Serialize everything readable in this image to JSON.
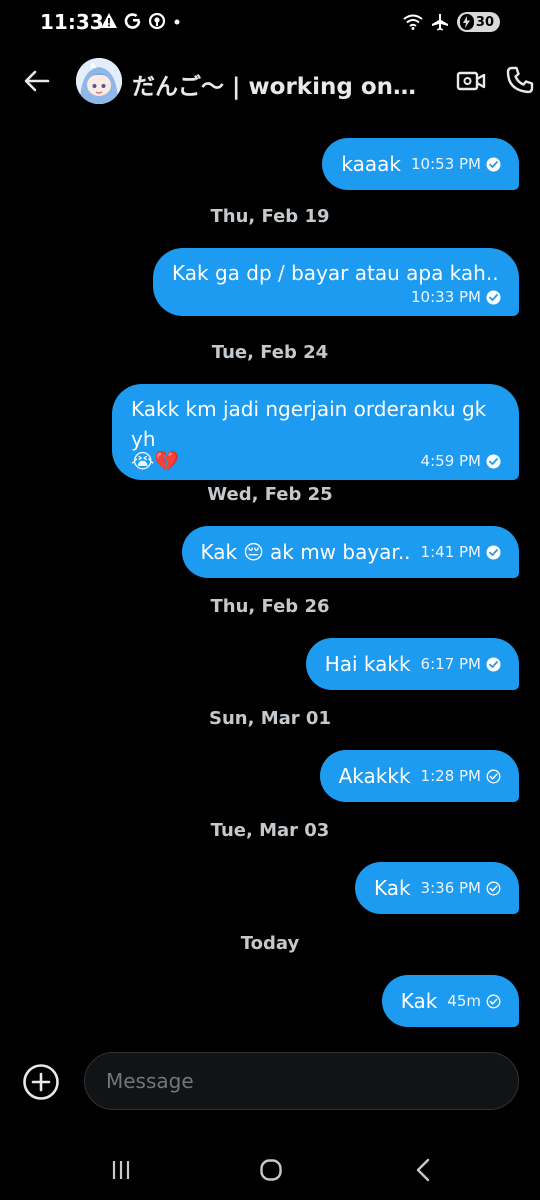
{
  "status_bar": {
    "time": "11:33",
    "battery": "30",
    "left_icons": [
      "warning-icon",
      "google-icon",
      "location-icon",
      "dot-icon"
    ],
    "right_icons": [
      "wifi-icon",
      "airplane-icon",
      "battery-icon"
    ]
  },
  "header": {
    "title": "だんご〜 | working on c...",
    "icons": [
      "back-arrow-icon",
      "avatar",
      "video-call-icon",
      "phone-icon"
    ]
  },
  "messages": [
    {
      "type": "bubble",
      "text": "kaaak",
      "time": "10:53 PM",
      "status": "read"
    },
    {
      "type": "date",
      "text": "Thu, Feb 19"
    },
    {
      "type": "bubble",
      "text": "Kak ga dp / bayar atau apa kah..",
      "time": "10:33 PM",
      "status": "read"
    },
    {
      "type": "date",
      "text": "Tue, Feb 24"
    },
    {
      "type": "bubble",
      "text": "Kakk km jadi ngerjain orderanku gk yh",
      "emoji": "😭💔",
      "time": "4:59 PM",
      "status": "read"
    },
    {
      "type": "date",
      "text": "Wed, Feb 25"
    },
    {
      "type": "bubble",
      "text_before": "Kak",
      "emoji": "😔",
      "text_after": "ak mw bayar..",
      "time": "1:41 PM",
      "status": "read"
    },
    {
      "type": "date",
      "text": "Thu, Feb 26"
    },
    {
      "type": "bubble",
      "text": "Hai kakk",
      "time": "6:17 PM",
      "status": "read"
    },
    {
      "type": "date",
      "text": "Sun, Mar 01"
    },
    {
      "type": "bubble",
      "text": "Akakkk",
      "time": "1:28 PM",
      "status": "sent"
    },
    {
      "type": "date",
      "text": "Tue, Mar 03"
    },
    {
      "type": "bubble",
      "text": "Kak",
      "time": "3:36 PM",
      "status": "sent"
    },
    {
      "type": "date",
      "text": "Today"
    },
    {
      "type": "bubble",
      "text": "Kak",
      "time": "45m",
      "status": "sent"
    }
  ],
  "composer": {
    "placeholder": "Message",
    "add_icon": "add-circle-icon"
  },
  "nav_bar": {
    "icons": [
      "recent-apps-icon",
      "home-icon",
      "back-icon"
    ]
  },
  "colors": {
    "bubble": "#1d9bf0",
    "background": "#000000",
    "date_text": "#c4c9cd"
  }
}
